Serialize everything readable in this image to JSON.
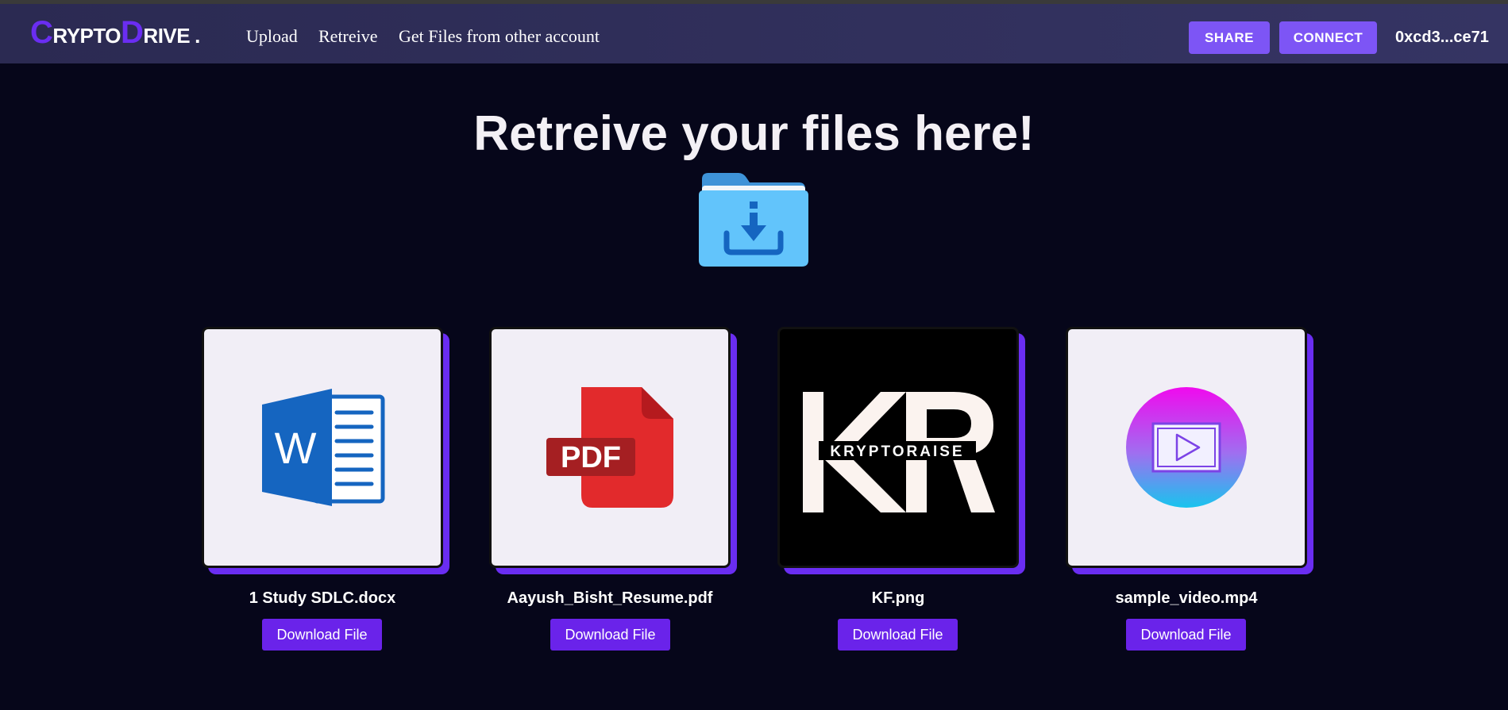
{
  "navbar": {
    "logo": {
      "c": "C",
      "rypto": "RYPTO",
      "d": "D",
      "rive": "RIVE",
      "dot": "."
    },
    "links": [
      "Upload",
      "Retreive",
      "Get Files from other account"
    ],
    "share_label": "SHARE",
    "connect_label": "CONNECT",
    "account": "0xcd3...ce71"
  },
  "main": {
    "heading": "Retreive your files here!",
    "files": [
      {
        "name": "1 Study SDLC.docx",
        "icon": "word-doc-icon",
        "download_label": "Download File"
      },
      {
        "name": "Aayush_Bisht_Resume.pdf",
        "icon": "pdf-icon",
        "download_label": "Download File"
      },
      {
        "name": "KF.png",
        "icon": "kryptoraise-logo-image",
        "image_text": "KRYPTORAISE",
        "download_label": "Download File"
      },
      {
        "name": "sample_video.mp4",
        "icon": "video-play-icon",
        "download_label": "Download File"
      }
    ]
  },
  "colors": {
    "background": "#06061a",
    "navbar": "#2b2a52",
    "accent": "#6a2df2",
    "button": "#7d55f5"
  }
}
